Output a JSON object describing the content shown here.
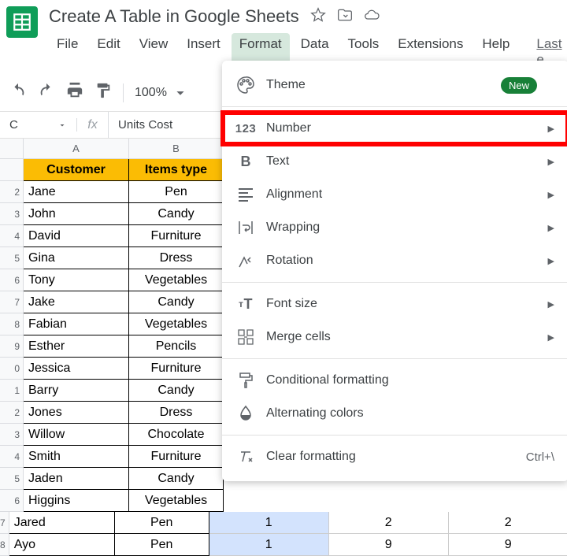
{
  "header": {
    "doc_title": "Create A Table in Google Sheets"
  },
  "menubar": {
    "items": [
      "File",
      "Edit",
      "View",
      "Insert",
      "Format",
      "Data",
      "Tools",
      "Extensions",
      "Help"
    ],
    "last_edit": "Last e",
    "active_index": 4
  },
  "toolbar": {
    "zoom": "100%"
  },
  "formula_bar": {
    "cell_ref": "C",
    "fx": "fx",
    "value": "Units Cost"
  },
  "columns": [
    "A",
    "B"
  ],
  "rows": [
    {
      "n": "",
      "a": "Customer",
      "b": "Items type",
      "header": true
    },
    {
      "n": "2",
      "a": "Jane",
      "b": "Pen"
    },
    {
      "n": "3",
      "a": "John",
      "b": "Candy"
    },
    {
      "n": "4",
      "a": "David",
      "b": "Furniture"
    },
    {
      "n": "5",
      "a": "Gina",
      "b": "Dress"
    },
    {
      "n": "6",
      "a": "Tony",
      "b": "Vegetables"
    },
    {
      "n": "7",
      "a": "Jake",
      "b": "Candy"
    },
    {
      "n": "8",
      "a": "Fabian",
      "b": "Vegetables"
    },
    {
      "n": "9",
      "a": "Esther",
      "b": "Pencils"
    },
    {
      "n": "0",
      "a": "Jessica",
      "b": "Furniture"
    },
    {
      "n": "1",
      "a": "Barry",
      "b": "Candy"
    },
    {
      "n": "2",
      "a": "Jones",
      "b": "Dress"
    },
    {
      "n": "3",
      "a": "Willow",
      "b": "Chocolate"
    },
    {
      "n": "4",
      "a": "Smith",
      "b": "Furniture"
    },
    {
      "n": "5",
      "a": "Jaden",
      "b": "Candy"
    },
    {
      "n": "6",
      "a": "Higgins",
      "b": "Vegetables"
    },
    {
      "n": "7",
      "a": "Jared",
      "b": "Pen",
      "c": "1",
      "d": "2",
      "e": "2"
    },
    {
      "n": "8",
      "a": "Ayo",
      "b": "Pen",
      "c": "1",
      "d": "9",
      "e": "9"
    }
  ],
  "dropdown": {
    "theme": "Theme",
    "new_badge": "New",
    "number": "Number",
    "text": "Text",
    "alignment": "Alignment",
    "wrapping": "Wrapping",
    "rotation": "Rotation",
    "font_size": "Font size",
    "merge_cells": "Merge cells",
    "conditional": "Conditional formatting",
    "alternating": "Alternating colors",
    "clear": "Clear formatting",
    "clear_shortcut": "Ctrl+\\"
  }
}
